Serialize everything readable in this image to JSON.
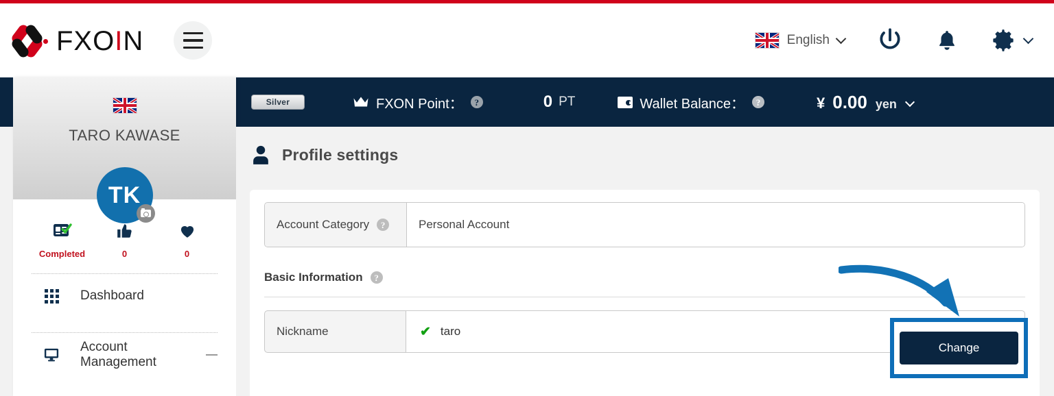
{
  "header": {
    "logo_text_main": "FXO",
    "logo_text_accent": "I",
    "logo_text_tail": "N",
    "menu_button": "hamburger-menu",
    "language": "English",
    "language_flag": "uk-flag",
    "power_icon": "power-icon",
    "bell_icon": "bell-icon",
    "gear_icon": "gear-icon"
  },
  "navbar": {
    "rank_badge": "Silver",
    "points_label": "FXON Point：",
    "points_help": "?",
    "points_value": "0",
    "points_unit": "PT",
    "wallet_label": "Wallet Balance：",
    "wallet_help": "?",
    "currency_symbol": "¥",
    "wallet_value": "0.00",
    "wallet_unit": "yen"
  },
  "sidebar": {
    "flag": "uk-flag",
    "user_name": "TARO KAWASE",
    "avatar_initials": "TK",
    "stats": [
      {
        "icon": "id-card-verified-icon",
        "label": "Completed"
      },
      {
        "icon": "thumbs-up-icon",
        "label": "0"
      },
      {
        "icon": "heart-icon",
        "label": "0"
      }
    ],
    "items": [
      {
        "label": "Dashboard",
        "icon": "grid-icon",
        "expandable": false
      },
      {
        "label": "Account Management",
        "icon": "monitor-icon",
        "expandable": true
      }
    ]
  },
  "main": {
    "page_title": "Profile settings",
    "page_icon": "person-icon",
    "account_category": {
      "label": "Account Category",
      "help": "?",
      "value": "Personal Account"
    },
    "basic_information": {
      "title": "Basic Information",
      "help": "?"
    },
    "nickname": {
      "label": "Nickname",
      "check": "✔",
      "value": "taro"
    },
    "change_button": "Change"
  },
  "colors": {
    "brand_red": "#d0021b",
    "navy": "#0a2540",
    "accent_blue": "#0e6eb8",
    "avatar_blue": "#1270ad",
    "stat_red": "#c1121f",
    "check_green": "#12a012",
    "page_bg": "#f2f2f2"
  }
}
